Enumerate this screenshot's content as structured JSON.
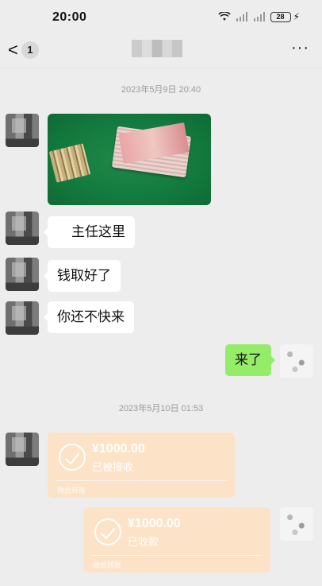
{
  "status_bar": {
    "time": "20:00",
    "battery": "28",
    "icons": [
      "wifi-icon",
      "signal-icon",
      "signal-icon",
      "battery-icon",
      "charging-icon"
    ]
  },
  "nav": {
    "back_glyph": "<",
    "unread_count": "1",
    "title": "",
    "more_glyph": "···"
  },
  "messages": {
    "timestamp_1": "2023年5月9日 20:40",
    "bubble_1": "主任这里",
    "bubble_2": "钱取好了",
    "bubble_3": "你还不快来",
    "bubble_4": "来了",
    "timestamp_2": "2023年5月10日 01:53",
    "transfer_1": {
      "amount": "¥1000.00",
      "status": "已被接收",
      "footer": "微信转账"
    },
    "transfer_2": {
      "amount": "¥1000.00",
      "status": "已收款",
      "footer": "微信转账"
    }
  },
  "colors": {
    "background": "#ededed",
    "bubble_self": "#95ec69",
    "bubble_other": "#ffffff",
    "transfer_card": "#fde3c6"
  }
}
